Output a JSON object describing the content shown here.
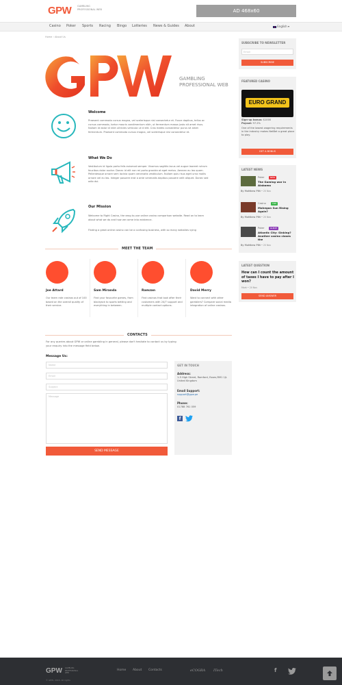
{
  "header": {
    "logo": "GPW",
    "logo_sub": "GAMBLING PROFESSIONAL WEB",
    "ad": "AD 468x60"
  },
  "nav": {
    "items": [
      "Casino",
      "Poker",
      "Sports",
      "Racing",
      "Bingo",
      "Lotteries",
      "News & Guides",
      "About"
    ],
    "lang": "English"
  },
  "breadcrumb": "Home › About Us",
  "hero": {
    "logo": "GPW",
    "subtitle": "GAMBLING PROFESSIONAL WEB"
  },
  "features": [
    {
      "title": "Welcome",
      "text": "Praesent commodo cursus magna, vel scelerisque nisl consectetur et. Fusce dapibus, tellus ac cursus commodo, tortor mauris condimentum nibh, ut fermentum massa justo sit amet risus. Nullam id dolor id nibh ultricies vehicula ut id elit. Cras mattis consectetur purus sit amet fermentum. Praesent commodo cursus magna, vel scelerisque nisl consectetur et."
    },
    {
      "title": "What We Do",
      "text": "Vestibulum id ligula porta felis euismod semper. Vivamus sagittis lacus vel augue laoreet rutrum faucibus dolor auctor. Donec id elit non mi porta gravida at eget metus. Aenean eu leo quam. Pellentesque ornare sem lacinia quam venenatis vestibulum. Nullam quis risus eget urna mollis ornare vel eu leo. Integer posuere erat a ante venenatis dapibus posuere velit aliquet. Donec sed odio dui."
    },
    {
      "title": "Our Mission",
      "text": "Welcome to Right Casino, the easy-to-use online casino comparison website. Read on to learn about what we do and how we came into existence.",
      "text2": "Finding a great online casino can be a confusing business, with so many websites vying"
    }
  ],
  "team": {
    "title": "MEET THE TEAM",
    "members": [
      {
        "name": "Joe Attard",
        "desc": "Our team rate casinos out of 100 based on the overall quality of their service."
      },
      {
        "name": "Sam Miranda",
        "desc": "Find your favourite games, from blackjack to sports betting and everything in between."
      },
      {
        "name": "Ramzan",
        "desc": "Find casinos that look after their customers with 24/7 support and multiple contact options."
      },
      {
        "name": "David Merry",
        "desc": "Want to connect with other gamblers? Compare social media integration of online casinos."
      }
    ]
  },
  "contacts": {
    "title": "CONTACTS",
    "intro": "For any queries about GPW or online gambling in general, please don't hesitate to contact us by typing your enquiry into the message field below.",
    "message_label": "Message Us:",
    "fields": [
      "Name",
      "Email",
      "Subject",
      "Message"
    ],
    "send": "SEND MESSAGE"
  },
  "touch": {
    "title": "GET IN TOUCH",
    "address_label": "Address:",
    "address": "1-5 High Street, Romford, Essex,RM1 1JL United Kingdom",
    "email_label": "Email Support:",
    "email": "support@gpw.pe",
    "phone_label": "Phone:",
    "phone": "01788 761 059"
  },
  "sidebar": {
    "newsletter": {
      "title": "SUBSCRIBE TO NEWSLETTER",
      "placeholder": "Email",
      "button": "SUBSCRIBE"
    },
    "featured": {
      "title": "FEATURED CASINO",
      "name": "EURO GRAND",
      "bonus_label": "Sign-up bonus:",
      "bonus": "$1000",
      "payout_label": "Payout:",
      "payout": "97.2%",
      "desc": "One of the lowest wagering requirements in the industry makes NetBet a great place to play.",
      "button": "GET A BONUS"
    },
    "news": {
      "title": "LATEST NEWS",
      "items": [
        {
          "cat": "Poker",
          "badge": "NEW",
          "badge_color": "#e8343a",
          "title": "The Gaming war in Alabama",
          "by": "By Matthew Pitt",
          "date": "20 Nov"
        },
        {
          "cat": "Casino",
          "badge": "TOP",
          "badge_color": "#3bb54a",
          "title": "Mohegan Sun Rising Again?",
          "by": "By Matthew Pitt",
          "date": "20 Nov"
        },
        {
          "cat": "Poker",
          "badge": "GUIDE",
          "badge_color": "#8e3fb8",
          "title": "Atlantic City: Sinking? Another casino closes the",
          "by": "By Matthew Pitt",
          "date": "20 Nov"
        }
      ]
    },
    "question": {
      "title": "LATEST QUESTION",
      "text": "How can I count the amount of taxes I have to pay after I won?",
      "by": "Mark",
      "date": "20 Nov",
      "button": "SEND ANSWER"
    }
  },
  "footer": {
    "logo": "GPW",
    "logo_sub": "GAMBLING PROFESSIONAL WEB",
    "links": [
      "Home",
      "About",
      "Contacts"
    ],
    "partners": [
      "eCOGRA",
      "ITech"
    ],
    "copyright": "© GPW, 2016. All rights"
  }
}
